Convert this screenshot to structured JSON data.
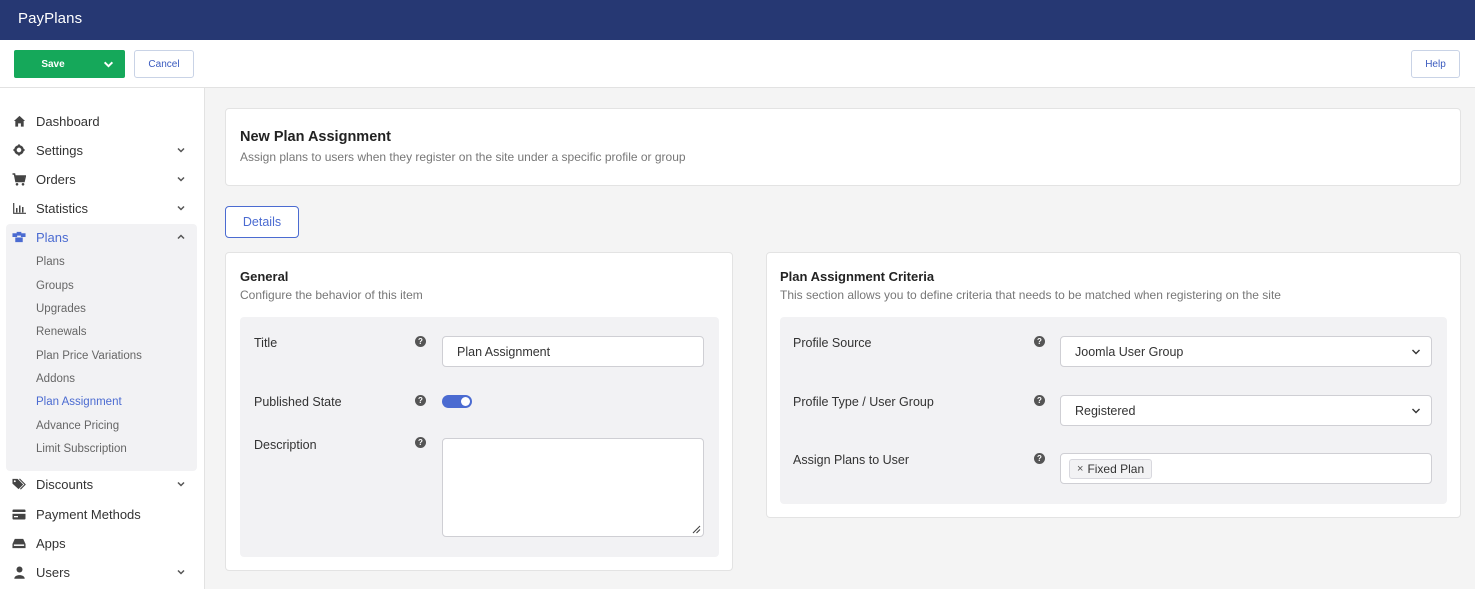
{
  "app": {
    "brand": "PayPlans"
  },
  "toolbar": {
    "save_label": "Save",
    "cancel_label": "Cancel",
    "help_label": "Help"
  },
  "sidebar": {
    "items": [
      {
        "label": "Dashboard",
        "icon": "home-icon"
      },
      {
        "label": "Settings",
        "icon": "gear-icon"
      },
      {
        "label": "Orders",
        "icon": "cart-icon"
      },
      {
        "label": "Statistics",
        "icon": "bar-chart-icon"
      },
      {
        "label": "Plans",
        "icon": "cubes-icon"
      },
      {
        "label": "Discounts",
        "icon": "tags-icon"
      },
      {
        "label": "Payment Methods",
        "icon": "credit-card-icon"
      },
      {
        "label": "Apps",
        "icon": "apps-icon"
      },
      {
        "label": "Users",
        "icon": "user-icon"
      }
    ],
    "plans_sub": [
      "Plans",
      "Groups",
      "Upgrades",
      "Renewals",
      "Plan Price Variations",
      "Addons",
      "Plan Assignment",
      "Advance Pricing",
      "Limit Subscription"
    ]
  },
  "header": {
    "title": "New Plan Assignment",
    "subtitle": "Assign plans to users when they register on the site under a specific profile or group"
  },
  "tabs": {
    "details": "Details"
  },
  "general": {
    "title": "General",
    "subtitle": "Configure the behavior of this item",
    "title_label": "Title",
    "title_value": "Plan Assignment",
    "published_label": "Published State",
    "description_label": "Description"
  },
  "criteria": {
    "title": "Plan Assignment Criteria",
    "subtitle": "This section allows you to define criteria that needs to be matched when registering on the site",
    "profile_source_label": "Profile Source",
    "profile_source_value": "Joomla User Group",
    "profile_type_label": "Profile Type / User Group",
    "profile_type_value": "Registered",
    "assign_label": "Assign Plans to User",
    "assigned_chip": "Fixed Plan"
  },
  "colors": {
    "topbar": "#263873",
    "save": "#15a85a",
    "accent": "#4b6bd1"
  }
}
